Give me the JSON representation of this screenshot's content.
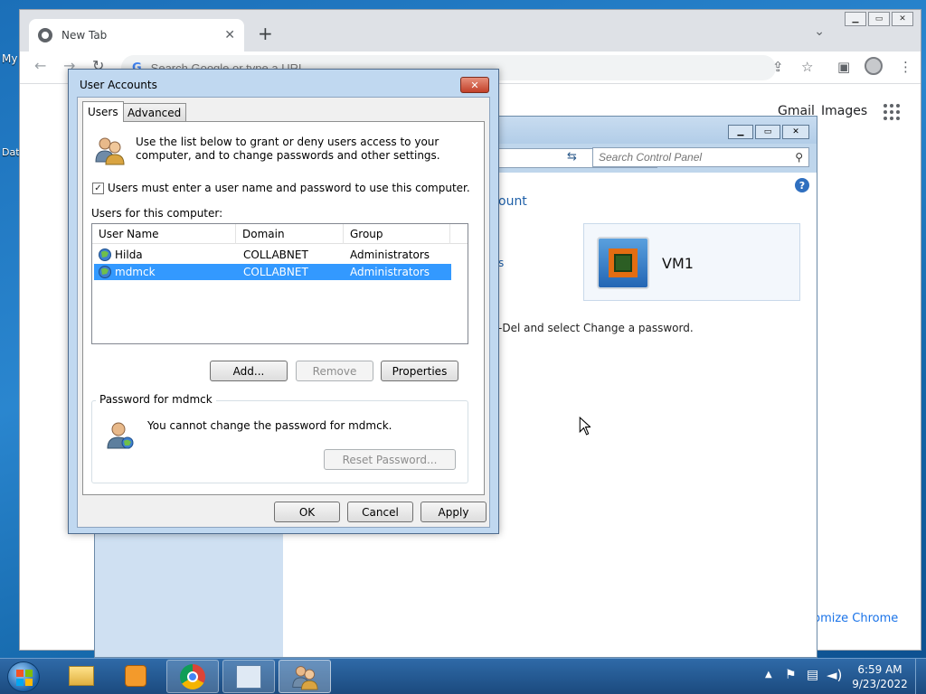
{
  "desktop": {
    "labels": [
      "My",
      "Dat"
    ]
  },
  "chrome": {
    "tab_title": "New Tab",
    "new_tab_symbol": "+",
    "close_symbol": "✕",
    "omnibox_placeholder": "Search Google or type a URL",
    "omnibox_g": "G",
    "links": {
      "gmail": "Gmail",
      "images": "Images"
    },
    "customize": "ustomize Chrome"
  },
  "control_panel": {
    "search_placeholder": "Search Control Panel",
    "heading_fragment": "ount",
    "link_fragment": "s",
    "body_fragment": "-Del and select Change a password.",
    "vm_name": "VM1",
    "help_symbol": "?"
  },
  "dialog": {
    "title": "User Accounts",
    "close_symbol": "✕",
    "tabs": [
      {
        "label": "Users",
        "active": true
      },
      {
        "label": "Advanced",
        "active": false
      }
    ],
    "info_text": "Use the list below to grant or deny users access to your computer, and to change passwords and other settings.",
    "require_login_label": "Users must enter a user name and password to use this computer.",
    "require_login_checked": true,
    "list_label": "Users for this computer:",
    "columns": [
      "User Name",
      "Domain",
      "Group"
    ],
    "users": [
      {
        "name": "Hilda",
        "domain": "COLLABNET",
        "group": "Administrators",
        "selected": false
      },
      {
        "name": "mdmck",
        "domain": "COLLABNET",
        "group": "Administrators",
        "selected": true
      }
    ],
    "buttons": {
      "add": "Add...",
      "remove": "Remove",
      "properties": "Properties",
      "reset_password": "Reset Password...",
      "ok": "OK",
      "cancel": "Cancel",
      "apply": "Apply"
    },
    "password_group_title": "Password for mdmck",
    "password_text": "You cannot change the password for mdmck."
  },
  "taskbar": {
    "time": "6:59 AM",
    "date": "9/23/2022"
  },
  "colors": {
    "selection": "#3399ff",
    "link": "#1e5fa8",
    "taskbar": "#1f4f86"
  }
}
